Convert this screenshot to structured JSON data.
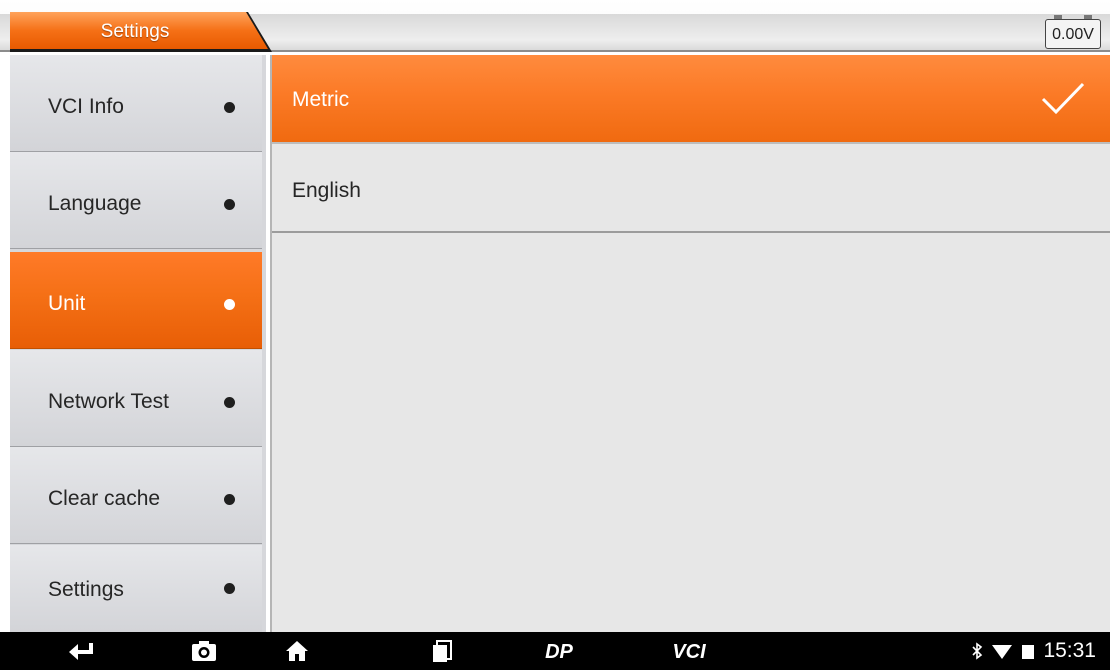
{
  "header": {
    "title": "Settings",
    "voltage": "0.00V"
  },
  "sidebar": {
    "items": [
      {
        "label": "VCI Info",
        "active": false
      },
      {
        "label": "Language",
        "active": false
      },
      {
        "label": "Unit",
        "active": true
      },
      {
        "label": "Network Test",
        "active": false
      },
      {
        "label": "Clear cache",
        "active": false
      },
      {
        "label": "Settings",
        "active": false
      }
    ]
  },
  "main": {
    "options": [
      {
        "label": "Metric",
        "selected": true
      },
      {
        "label": "English",
        "selected": false
      }
    ]
  },
  "navbar": {
    "icons": [
      "back-icon",
      "camera-icon",
      "home-icon",
      "recent-apps-icon",
      "dp-icon",
      "vci-icon"
    ],
    "dp_label": "DP",
    "vci_label": "VCI"
  },
  "status_bar": {
    "time": "15:31",
    "icons": [
      "bluetooth-icon",
      "wifi-icon",
      "battery-icon"
    ]
  },
  "colors": {
    "accent": "#f57016",
    "accent_light": "#ff8b3e",
    "sidebar_bg": "#d6d7db",
    "content_bg": "#e7e7e7",
    "navbar_bg": "#000000"
  }
}
